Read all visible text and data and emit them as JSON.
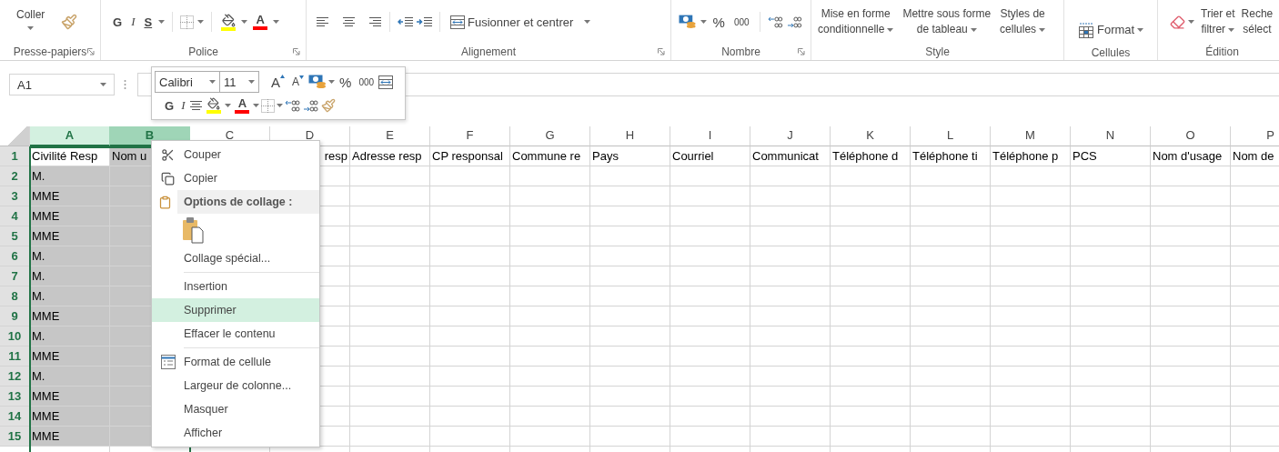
{
  "ribbon": {
    "clipboard": {
      "paste": "Coller",
      "label": "Presse-papiers"
    },
    "font": {
      "bold": "G",
      "italic": "I",
      "underline": "S",
      "font_color": "A",
      "label": "Police"
    },
    "alignment": {
      "merge": "Fusionner et centrer",
      "label": "Alignement"
    },
    "number": {
      "percent": "%",
      "thousands": "000",
      "label": "Nombre"
    },
    "style": {
      "buttons": [
        {
          "lines": [
            "Mise en forme",
            "conditionnelle"
          ],
          "caret": true
        },
        {
          "lines": [
            "Mettre sous forme",
            "de tableau"
          ],
          "caret": true
        },
        {
          "lines": [
            "Styles de",
            "cellules"
          ],
          "caret": true
        }
      ],
      "label": "Style"
    },
    "cells": {
      "format": "Format",
      "label": "Cellules"
    },
    "editing": {
      "buttons": [
        {
          "lines": [
            "Trier et",
            "filtrer"
          ],
          "caret": true
        },
        {
          "lines": [
            "Reche",
            "sélect"
          ],
          "caret": false
        }
      ],
      "label": "Édition"
    }
  },
  "name_box": {
    "value": "A1"
  },
  "mini_toolbar": {
    "font": "Calibri",
    "size": "11",
    "grow": "A",
    "shrink": "A",
    "percent": "%",
    "thousands": "000",
    "bold": "G",
    "italic": "I",
    "font_color": "A"
  },
  "sheet": {
    "columns": [
      {
        "label": "A",
        "selected": true,
        "hovered": false
      },
      {
        "label": "B",
        "selected": true,
        "hovered": true
      },
      {
        "label": "C",
        "selected": false,
        "hovered": false
      },
      {
        "label": "D",
        "selected": false,
        "hovered": false
      },
      {
        "label": "E",
        "selected": false,
        "hovered": false
      },
      {
        "label": "F",
        "selected": false,
        "hovered": false
      },
      {
        "label": "G",
        "selected": false,
        "hovered": false
      },
      {
        "label": "H",
        "selected": false,
        "hovered": false
      },
      {
        "label": "I",
        "selected": false,
        "hovered": false
      },
      {
        "label": "J",
        "selected": false,
        "hovered": false
      },
      {
        "label": "K",
        "selected": false,
        "hovered": false
      },
      {
        "label": "L",
        "selected": false,
        "hovered": false
      },
      {
        "label": "M",
        "selected": false,
        "hovered": false
      },
      {
        "label": "N",
        "selected": false,
        "hovered": false
      },
      {
        "label": "O",
        "selected": false,
        "hovered": false
      },
      {
        "label": "P",
        "selected": false,
        "hovered": false
      }
    ],
    "rows": [
      {
        "number": "1",
        "selected": true,
        "cells": [
          {
            "text": "Civilité Resp",
            "active": true,
            "clipped_start": false
          },
          {
            "text": "Nom u",
            "active": false,
            "clipped_start": false
          },
          {
            "text": ""
          },
          {
            "text": "resp",
            "active": false,
            "clipped_start": true
          },
          {
            "text": "Adresse resp",
            "active": false,
            "clipped_start": false
          },
          {
            "text": "CP responsal",
            "active": false,
            "clipped_start": false
          },
          {
            "text": "Commune re",
            "active": false,
            "clipped_start": false
          },
          {
            "text": "Pays",
            "active": false,
            "clipped_start": false
          },
          {
            "text": "Courriel",
            "active": false,
            "clipped_start": false
          },
          {
            "text": "Communicat",
            "active": false,
            "clipped_start": false
          },
          {
            "text": "Téléphone d",
            "active": false,
            "clipped_start": false
          },
          {
            "text": "Téléphone ti",
            "active": false,
            "clipped_start": false
          },
          {
            "text": "Téléphone p",
            "active": false,
            "clipped_start": false
          },
          {
            "text": "PCS",
            "active": false,
            "clipped_start": false
          },
          {
            "text": "Nom d'usage",
            "active": false,
            "clipped_start": false
          },
          {
            "text": "Nom de",
            "active": false,
            "clipped_start": false
          }
        ]
      },
      {
        "number": "2",
        "selected": true,
        "cells": [
          {
            "text": "M.",
            "active": false,
            "clipped_start": false
          }
        ]
      },
      {
        "number": "3",
        "selected": true,
        "cells": [
          {
            "text": "MME",
            "active": false,
            "clipped_start": false
          }
        ]
      },
      {
        "number": "4",
        "selected": true,
        "cells": [
          {
            "text": "MME",
            "active": false,
            "clipped_start": false
          }
        ]
      },
      {
        "number": "5",
        "selected": true,
        "cells": [
          {
            "text": "MME",
            "active": false,
            "clipped_start": false
          }
        ]
      },
      {
        "number": "6",
        "selected": true,
        "cells": [
          {
            "text": "M.",
            "active": false,
            "clipped_start": false
          }
        ]
      },
      {
        "number": "7",
        "selected": true,
        "cells": [
          {
            "text": "M.",
            "active": false,
            "clipped_start": false
          }
        ]
      },
      {
        "number": "8",
        "selected": true,
        "cells": [
          {
            "text": "M.",
            "active": false,
            "clipped_start": false
          }
        ]
      },
      {
        "number": "9",
        "selected": true,
        "cells": [
          {
            "text": "MME",
            "active": false,
            "clipped_start": false
          }
        ]
      },
      {
        "number": "10",
        "selected": true,
        "cells": [
          {
            "text": "M.",
            "active": false,
            "clipped_start": false
          }
        ]
      },
      {
        "number": "11",
        "selected": true,
        "cells": [
          {
            "text": "MME",
            "active": false,
            "clipped_start": false
          }
        ]
      },
      {
        "number": "12",
        "selected": true,
        "cells": [
          {
            "text": "M.",
            "active": false,
            "clipped_start": false
          }
        ]
      },
      {
        "number": "13",
        "selected": true,
        "cells": [
          {
            "text": "MME",
            "active": false,
            "clipped_start": false
          }
        ]
      },
      {
        "number": "14",
        "selected": true,
        "cells": [
          {
            "text": "MME",
            "active": false,
            "clipped_start": false
          }
        ]
      },
      {
        "number": "15",
        "selected": true,
        "cells": [
          {
            "text": "MME",
            "active": false,
            "clipped_start": false
          }
        ]
      }
    ]
  },
  "context_menu": {
    "items": [
      {
        "kind": "cut",
        "label": "Couper",
        "highlighted": false
      },
      {
        "kind": "copy",
        "label": "Copier",
        "highlighted": false
      },
      {
        "kind": "paste_header",
        "label": "Options de collage :"
      },
      {
        "kind": "paste_option"
      },
      {
        "kind": "command",
        "label": "Collage spécial...",
        "highlighted": false
      },
      {
        "kind": "separator"
      },
      {
        "kind": "command",
        "label": "Insertion",
        "highlighted": false
      },
      {
        "kind": "command",
        "label": "Supprimer",
        "highlighted": true
      },
      {
        "kind": "command",
        "label": "Effacer le contenu",
        "highlighted": false
      },
      {
        "kind": "separator"
      },
      {
        "kind": "format",
        "label": "Format de cellule",
        "highlighted": false
      },
      {
        "kind": "command",
        "label": "Largeur de colonne...",
        "highlighted": false
      },
      {
        "kind": "command",
        "label": "Masquer",
        "highlighted": false
      },
      {
        "kind": "command",
        "label": "Afficher",
        "highlighted": false
      }
    ]
  }
}
